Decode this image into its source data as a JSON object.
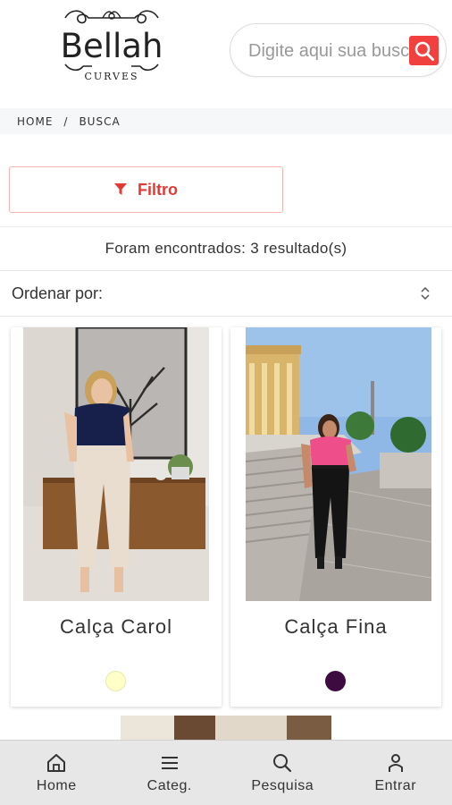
{
  "brand": {
    "name": "Bellah",
    "tagline": "CURVES"
  },
  "search": {
    "placeholder": "Digite aqui sua busca"
  },
  "breadcrumb": {
    "home": "HOME",
    "separator": "/",
    "current": "BUSCA"
  },
  "filter": {
    "label": "Filtro"
  },
  "results": {
    "text": "Foram encontrados: 3 resultado(s)"
  },
  "sort": {
    "label": "Ordenar por:"
  },
  "products": [
    {
      "name": "Calça Carol",
      "color": "#ffffc8"
    },
    {
      "name": "Calça Fina",
      "color": "#3d0b3f"
    }
  ],
  "bottom_nav": [
    {
      "label": "Home",
      "icon": "home-icon"
    },
    {
      "label": "Categ.",
      "icon": "menu-icon"
    },
    {
      "label": "Pesquisa",
      "icon": "search-icon"
    },
    {
      "label": "Entrar",
      "icon": "user-icon"
    }
  ],
  "colors": {
    "accent": "#f2403f",
    "nav_bg": "#e7e7e7",
    "breadcrumb_bg": "#f5f7f9"
  }
}
